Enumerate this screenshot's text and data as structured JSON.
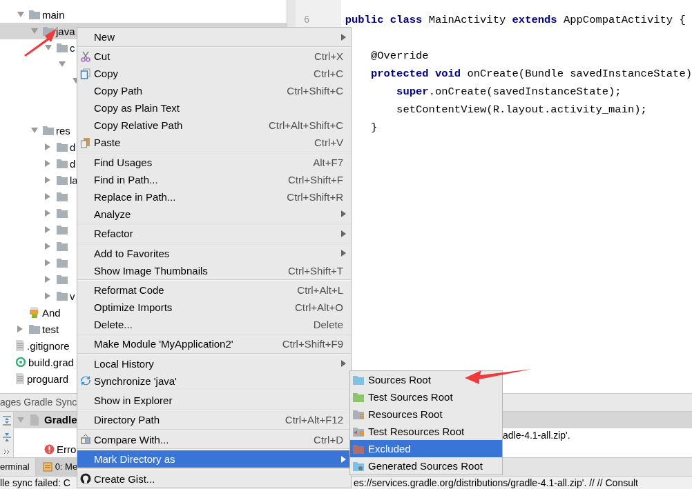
{
  "project_tree": [
    {
      "label": "main",
      "kind": "folder",
      "expanded": true,
      "selected": false,
      "children": [
        {
          "label": "java",
          "kind": "folder",
          "expanded": true,
          "selected": true,
          "children": [
            {
              "label": "c",
              "kind": "folder",
              "expanded": true,
              "selected": false,
              "children": [
                {
                  "expanded": true,
                  "selected": false,
                  "children": [
                    {
                      "expanded": true,
                      "selected": false
                    }
                  ]
                }
              ]
            }
          ]
        },
        {
          "label": "res",
          "kind": "folder",
          "expanded": true,
          "selected": false,
          "children": [
            {
              "label": "d",
              "kind": "folder",
              "expanded": false,
              "selected": false
            },
            {
              "label": "d",
              "kind": "folder",
              "expanded": false,
              "selected": false
            },
            {
              "label": "la",
              "kind": "folder",
              "expanded": false,
              "selected": false
            },
            {
              "kind": "folder",
              "expanded": false,
              "selected": false
            },
            {
              "kind": "folder",
              "expanded": false,
              "selected": false
            },
            {
              "kind": "folder",
              "expanded": false,
              "selected": false
            },
            {
              "kind": "folder",
              "expanded": false,
              "selected": false
            },
            {
              "kind": "folder",
              "expanded": false,
              "selected": false
            },
            {
              "kind": "folder",
              "expanded": false,
              "selected": false
            },
            {
              "label": "v",
              "kind": "folder",
              "expanded": false,
              "selected": false
            }
          ]
        },
        {
          "label": "And",
          "kind": "manifest",
          "selected": false
        }
      ]
    },
    {
      "label": "test",
      "kind": "folder",
      "expanded": false,
      "selected": false
    },
    {
      "label": ".gitignore",
      "kind": "file",
      "selected": false
    },
    {
      "label": "build.grad",
      "kind": "gradle",
      "selected": false
    },
    {
      "label": "proguard",
      "kind": "file",
      "selected": false
    }
  ],
  "editor": {
    "line_number": "6",
    "class_line": [
      {
        "text": "public class ",
        "kind": "keyword"
      },
      {
        "text": "MainActivity ",
        "kind": "plain"
      },
      {
        "text": "extends ",
        "kind": "keyword"
      },
      {
        "text": "AppCompatActivity {",
        "kind": "plain"
      }
    ],
    "method_lines": [
      [
        {
          "text": "    @Override",
          "kind": "plain"
        }
      ],
      [
        {
          "text": "    protected void ",
          "kind": "keyword"
        },
        {
          "text": "onCreate(Bundle savedInstanceState)",
          "kind": "plain"
        }
      ],
      [
        {
          "text": "        super",
          "kind": "keyword"
        },
        {
          "text": ".onCreate(savedInstanceState);",
          "kind": "plain"
        }
      ],
      [
        {
          "text": "        setContentView(R.layout.activity_main);",
          "kind": "plain"
        }
      ],
      [
        {
          "text": "    }",
          "kind": "plain"
        }
      ]
    ]
  },
  "context_menu": {
    "items": [
      {
        "kind": "plain",
        "label": "New",
        "submenu": true,
        "selected": false
      },
      {
        "kind": "separator"
      },
      {
        "kind": "cut",
        "label": "Cut",
        "shortcut": "Ctrl+X",
        "selected": false
      },
      {
        "kind": "copy",
        "label": "Copy",
        "shortcut": "Ctrl+C",
        "selected": false
      },
      {
        "kind": "plain",
        "label": "Copy Path",
        "shortcut": "Ctrl+Shift+C",
        "selected": false
      },
      {
        "kind": "plain",
        "label": "Copy as Plain Text",
        "selected": false
      },
      {
        "kind": "plain",
        "label": "Copy Relative Path",
        "shortcut": "Ctrl+Alt+Shift+C",
        "selected": false
      },
      {
        "kind": "paste",
        "label": "Paste",
        "shortcut": "Ctrl+V",
        "selected": false
      },
      {
        "kind": "separator"
      },
      {
        "kind": "plain",
        "label": "Find Usages",
        "shortcut": "Alt+F7",
        "selected": false
      },
      {
        "kind": "plain",
        "label": "Find in Path...",
        "shortcut": "Ctrl+Shift+F",
        "selected": false
      },
      {
        "kind": "plain",
        "label": "Replace in Path...",
        "shortcut": "Ctrl+Shift+R",
        "selected": false
      },
      {
        "kind": "plain",
        "label": "Analyze",
        "submenu": true,
        "selected": false
      },
      {
        "kind": "separator"
      },
      {
        "kind": "plain",
        "label": "Refactor",
        "submenu": true,
        "selected": false
      },
      {
        "kind": "separator"
      },
      {
        "kind": "plain",
        "label": "Add to Favorites",
        "submenu": true,
        "selected": false
      },
      {
        "kind": "plain",
        "label": "Show Image Thumbnails",
        "shortcut": "Ctrl+Shift+T",
        "selected": false
      },
      {
        "kind": "separator"
      },
      {
        "kind": "plain",
        "label": "Reformat Code",
        "shortcut": "Ctrl+Alt+L",
        "selected": false
      },
      {
        "kind": "plain",
        "label": "Optimize Imports",
        "shortcut": "Ctrl+Alt+O",
        "selected": false
      },
      {
        "kind": "plain",
        "label": "Delete...",
        "shortcut": "Delete",
        "selected": false
      },
      {
        "kind": "separator"
      },
      {
        "kind": "plain",
        "label": "Make Module 'MyApplication2'",
        "shortcut": "Ctrl+Shift+F9",
        "selected": false
      },
      {
        "kind": "separator"
      },
      {
        "kind": "plain",
        "label": "Local History",
        "submenu": true,
        "selected": false
      },
      {
        "kind": "sync",
        "label": "Synchronize 'java'",
        "selected": false
      },
      {
        "kind": "separator"
      },
      {
        "kind": "plain",
        "label": "Show in Explorer",
        "selected": false
      },
      {
        "kind": "separator"
      },
      {
        "kind": "plain",
        "label": "Directory Path",
        "shortcut": "Ctrl+Alt+F12",
        "selected": false
      },
      {
        "kind": "separator"
      },
      {
        "kind": "compare",
        "label": "Compare With...",
        "shortcut": "Ctrl+D",
        "selected": false
      },
      {
        "kind": "separator"
      },
      {
        "kind": "plain",
        "label": "Mark Directory as",
        "submenu": true,
        "selected": true
      },
      {
        "kind": "separator"
      },
      {
        "kind": "gist",
        "label": "Create Gist...",
        "selected": false
      }
    ]
  },
  "submenu": {
    "items": [
      {
        "kind": "sources",
        "label": "Sources Root",
        "selected": false
      },
      {
        "kind": "test_sources",
        "label": "Test Sources Root",
        "selected": false
      },
      {
        "kind": "resources",
        "label": "Resources Root",
        "selected": false
      },
      {
        "kind": "test_resources",
        "label": "Test Resources Root",
        "selected": false
      },
      {
        "kind": "excluded",
        "label": "Excluded",
        "selected": true
      },
      {
        "kind": "generated",
        "label": "Generated Sources Root",
        "selected": false
      }
    ]
  },
  "tool_window": {
    "title": "ages Gradle Sync",
    "header": {
      "label": "Gradle",
      "expanded": true
    },
    "message_tail": "adle-4.1-all.zip'.",
    "error": "Erro",
    "tabs": [
      {
        "label": "erminal",
        "selected": false
      },
      {
        "label": "0: Me",
        "selected": true
      }
    ]
  },
  "status_bar": {
    "left": "lle sync failed: C",
    "right": "es://services.gradle.org/distributions/gradle-4.1-all.zip'. // // Consult"
  }
}
